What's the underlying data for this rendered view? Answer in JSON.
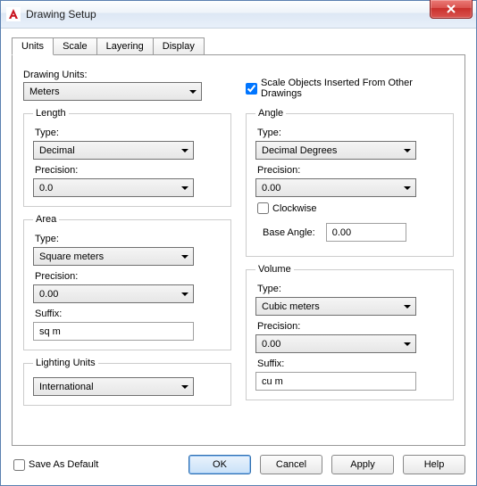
{
  "window": {
    "title": "Drawing Setup"
  },
  "tabs": {
    "units": "Units",
    "scale": "Scale",
    "layering": "Layering",
    "display": "Display"
  },
  "drawingUnits": {
    "label": "Drawing Units:",
    "value": "Meters"
  },
  "scaleObjects": {
    "label": "Scale Objects Inserted From Other Drawings",
    "checked": true
  },
  "length": {
    "legend": "Length",
    "typeLabel": "Type:",
    "type": "Decimal",
    "precisionLabel": "Precision:",
    "precision": "0.0"
  },
  "area": {
    "legend": "Area",
    "typeLabel": "Type:",
    "type": "Square meters",
    "precisionLabel": "Precision:",
    "precision": "0.00",
    "suffixLabel": "Suffix:",
    "suffix": "sq m"
  },
  "lighting": {
    "legend": "Lighting Units",
    "value": "International"
  },
  "angle": {
    "legend": "Angle",
    "typeLabel": "Type:",
    "type": "Decimal Degrees",
    "precisionLabel": "Precision:",
    "precision": "0.00",
    "clockwiseLabel": "Clockwise",
    "clockwise": false,
    "baseLabel": "Base Angle:",
    "base": "0.00"
  },
  "volume": {
    "legend": "Volume",
    "typeLabel": "Type:",
    "type": "Cubic meters",
    "precisionLabel": "Precision:",
    "precision": "0.00",
    "suffixLabel": "Suffix:",
    "suffix": "cu m"
  },
  "saveDefault": {
    "label": "Save As Default",
    "checked": false
  },
  "buttons": {
    "ok": "OK",
    "cancel": "Cancel",
    "apply": "Apply",
    "help": "Help"
  }
}
